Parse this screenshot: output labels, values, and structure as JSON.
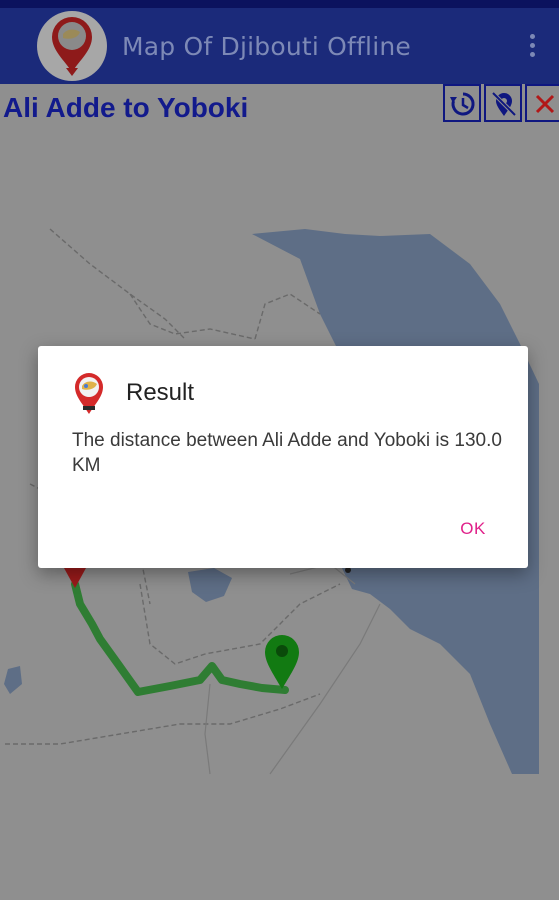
{
  "appbar": {
    "title": "Map Of Djibouti Offline",
    "logo_icon": "map-pin-logo-icon",
    "overflow_icon": "more-vert-icon"
  },
  "map": {
    "route_title": "Ali Adde  to Yoboki",
    "tools": [
      {
        "name": "reset-route",
        "icon": "history-icon"
      },
      {
        "name": "clear-markers",
        "icon": "location-off-icon"
      },
      {
        "name": "close",
        "icon": "close-icon"
      }
    ],
    "route_color": "#2f7d33",
    "start_marker_color": "#9b1b1b",
    "end_marker_color": "#127a12",
    "water_color": "#5e6e86"
  },
  "dialog": {
    "title": "Result",
    "message": "The distance between Ali Adde  and Yoboki is 130.0 KM",
    "ok_label": "OK",
    "icon": "map-pin-icon",
    "accent_color": "#e0218a"
  }
}
